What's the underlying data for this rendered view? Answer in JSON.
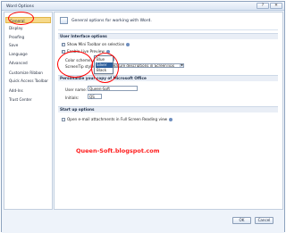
{
  "window": {
    "title": "Word Options",
    "help": "?",
    "close": "✕"
  },
  "sidebar": {
    "items": [
      {
        "label": "General"
      },
      {
        "label": "Display"
      },
      {
        "label": "Proofing"
      },
      {
        "label": "Save"
      },
      {
        "label": "Language"
      },
      {
        "label": "Advanced"
      },
      {
        "label": "Customize Ribbon"
      },
      {
        "label": "Quick Access Toolbar"
      },
      {
        "label": "Add-Ins"
      },
      {
        "label": "Trust Center"
      }
    ]
  },
  "content": {
    "header": "General options for working with Word.",
    "ui_section": "User Interface options",
    "ui": {
      "mini_toolbar": "Show Mini Toolbar on selection",
      "live_preview": "Enable Live Preview",
      "color_scheme_label": "Color scheme:",
      "color_scheme_value": "Silver",
      "screentip_label": "ScreenTip style:",
      "screentip_value": "Show feature descriptions in ScreenTips"
    },
    "dropdown_options": [
      "Blue",
      "Silver",
      "Black"
    ],
    "personalize_section": "Personalize your copy of Microsoft Office",
    "personalize": {
      "user_name_label": "User name:",
      "user_name_value": "Queen-Soft",
      "initials_label": "Initials:",
      "initials_value": "QS"
    },
    "startup_section": "Start up options",
    "startup": {
      "open_email": "Open e-mail attachments in Full Screen Reading view"
    },
    "watermark": "Queen-Soft.blogspot.com"
  },
  "footer": {
    "ok": "OK",
    "cancel": "Cancel"
  },
  "colors": {
    "accent": "#2d5f9c",
    "highlight": "#ff0000",
    "selected_nav": "#f6d98a"
  }
}
